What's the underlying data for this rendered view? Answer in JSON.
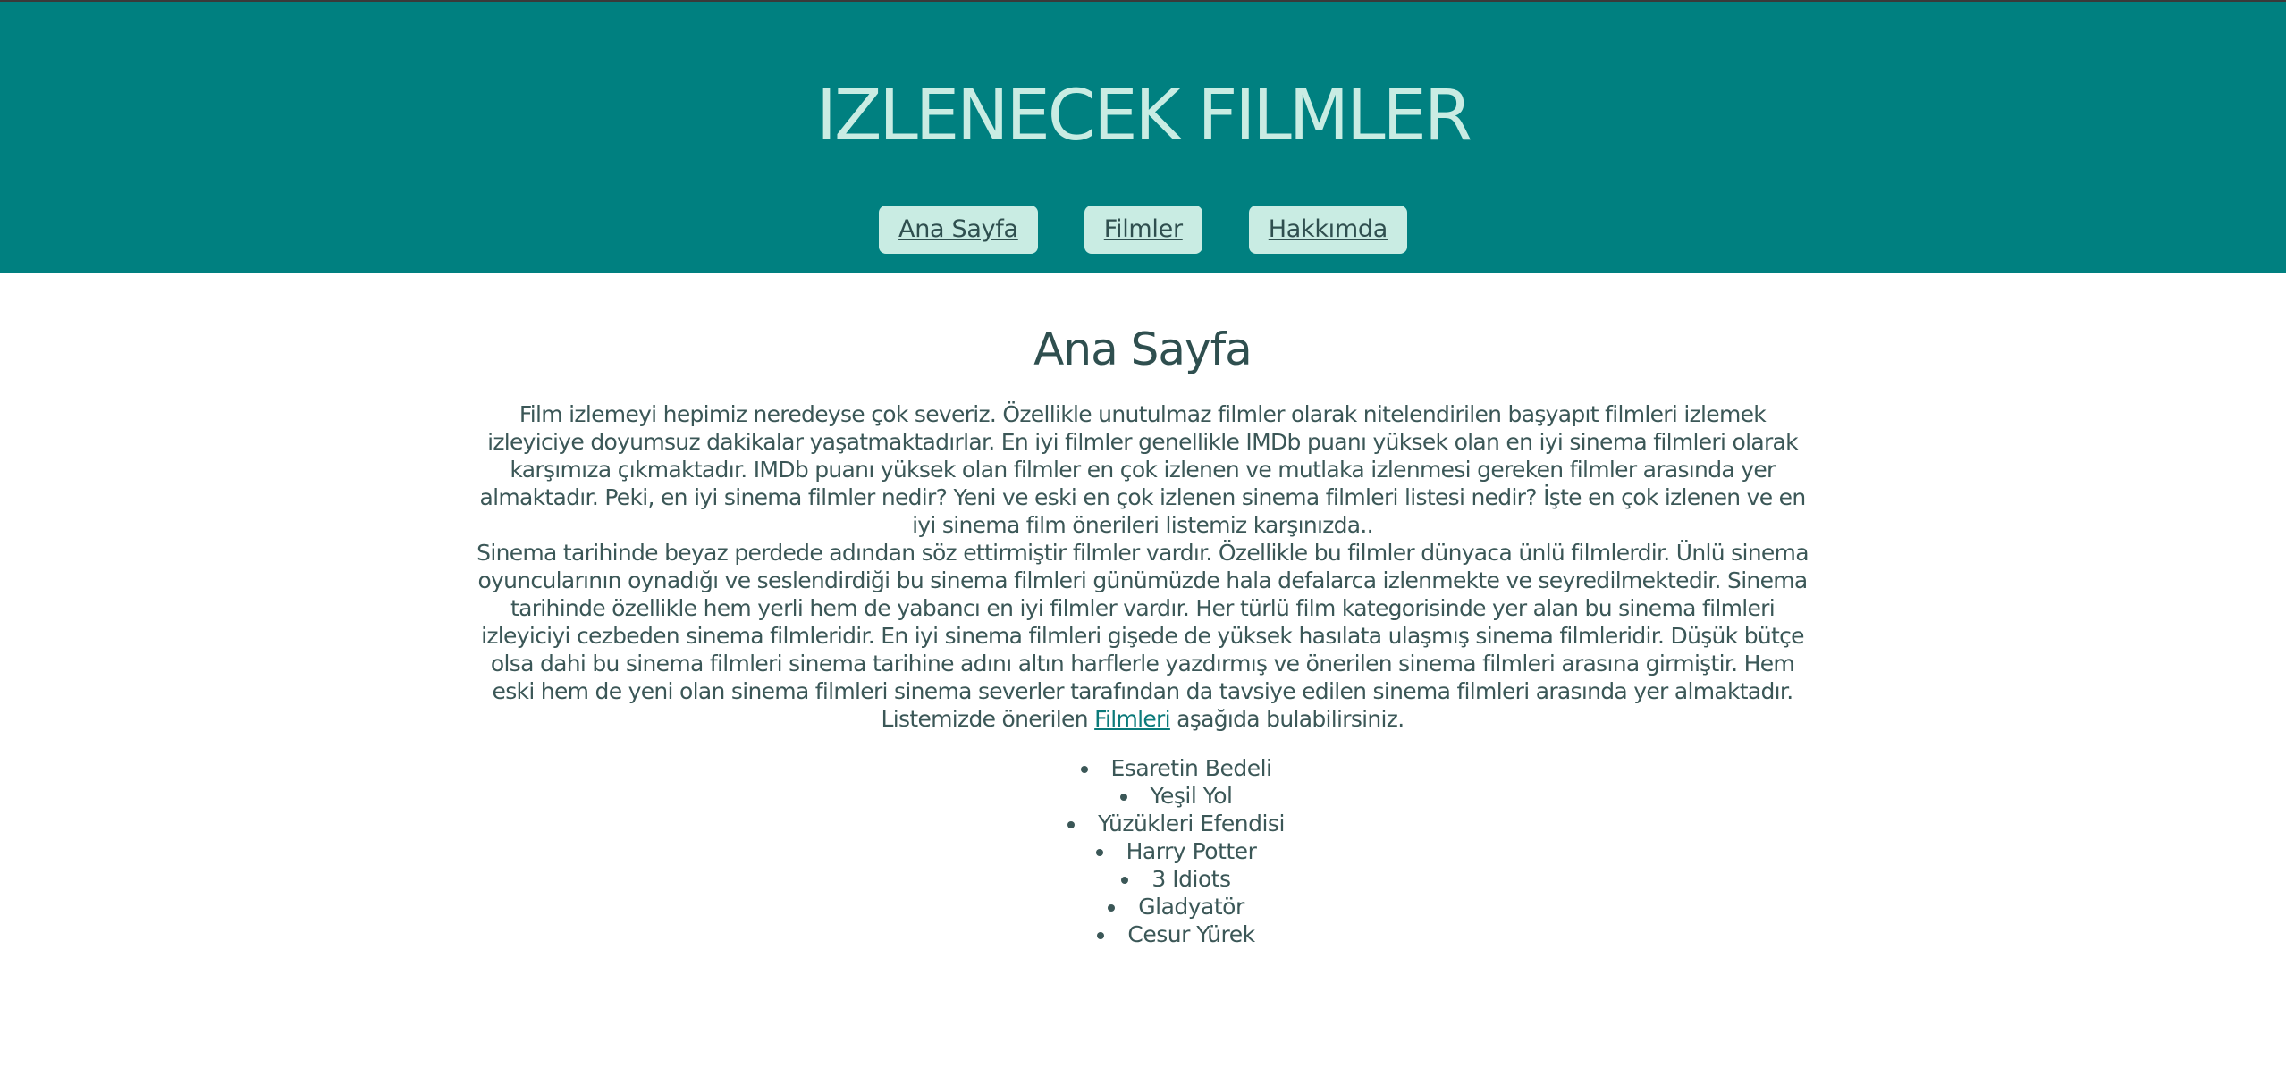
{
  "header": {
    "title": "IZLENECEK FILMLER",
    "nav": [
      {
        "label": "Ana Sayfa"
      },
      {
        "label": "Filmler"
      },
      {
        "label": "Hakkımda"
      }
    ]
  },
  "main": {
    "page_title": "Ana Sayfa",
    "paragraph_1": "Film izlemeyi hepimiz neredeyse çok severiz. Özellikle unutulmaz filmler olarak nitelendirilen başyapıt filmleri izlemek izleyiciye doyumsuz dakikalar yaşatmaktadırlar. En iyi filmler genellikle IMDb puanı yüksek olan en iyi sinema filmleri olarak karşımıza çıkmaktadır. IMDb puanı yüksek olan filmler en çok izlenen ve mutlaka izlenmesi gereken filmler arasında yer almaktadır. Peki, en iyi sinema filmler nedir? Yeni ve eski en çok izlenen sinema filmleri listesi nedir? İşte en çok izlenen ve en iyi sinema film önerileri listemiz karşınızda..",
    "paragraph_2": "Sinema tarihinde beyaz perdede adından söz ettirmiştir filmler vardır. Özellikle bu filmler dünyaca ünlü filmlerdir. Ünlü sinema oyuncularının oynadığı ve seslendirdiği bu sinema filmleri günümüzde hala defalarca izlenmekte ve seyredilmektedir. Sinema tarihinde özellikle hem yerli hem de yabancı en iyi filmler vardır. Her türlü film kategorisinde yer alan bu sinema filmleri izleyiciyi cezbeden sinema filmleridir. En iyi sinema filmleri gişede de yüksek hasılata ulaşmış sinema filmleridir. Düşük bütçe olsa dahi bu sinema filmleri sinema tarihine adını altın harflerle yazdırmış ve önerilen sinema filmleri arasına girmiştir. Hem eski hem de yeni olan sinema filmleri sinema severler tarafından da tavsiye edilen sinema filmleri arasında yer almaktadır.",
    "paragraph_3_before": "Listemizde önerilen ",
    "paragraph_3_link": "Filmleri",
    "paragraph_3_after": " aşağıda bulabilirsiniz.",
    "films": [
      "Esaretin Bedeli",
      "Yeşil Yol",
      "Yüzükleri Efendisi",
      "Harry Potter",
      "3 Idiots",
      "Gladyatör",
      "Cesur Yürek"
    ]
  },
  "colors": {
    "header_bg": "#008080",
    "title_text": "#c9ece3",
    "nav_button_bg": "#c9ece3",
    "body_text": "#2f4f4f",
    "link": "#0b7a7a"
  }
}
